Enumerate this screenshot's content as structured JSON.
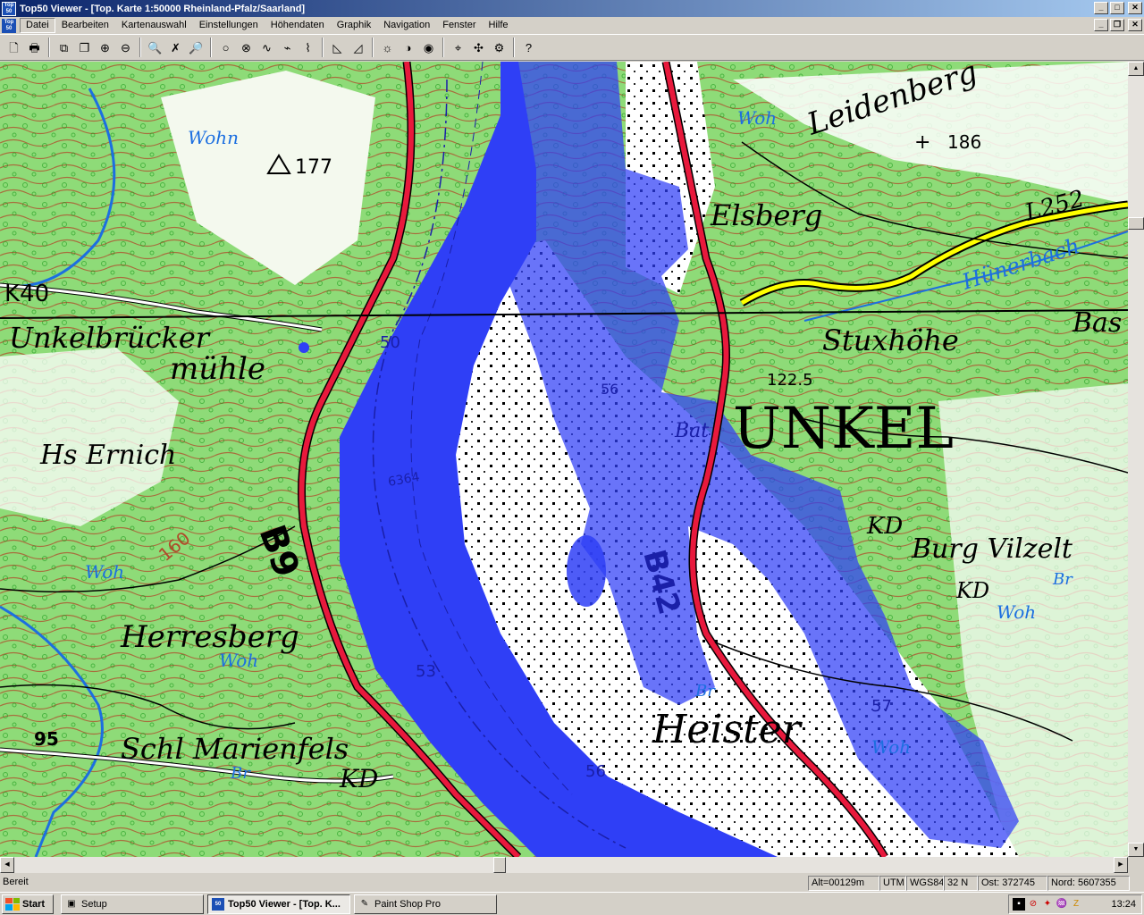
{
  "window": {
    "title": "Top50 Viewer - [Top. Karte 1:50000 Rheinland-Pfalz/Saarland]",
    "app_icon_text": [
      "Top",
      "50"
    ],
    "minimize": "_",
    "maximize": "□",
    "close": "✕"
  },
  "menu": {
    "items": [
      "Datei",
      "Bearbeiten",
      "Kartenauswahl",
      "Einstellungen",
      "Höhendaten",
      "Graphik",
      "Navigation",
      "Fenster",
      "Hilfe"
    ],
    "active_index": 0,
    "mdi_minimize": "_",
    "mdi_restore": "❐",
    "mdi_close": "✕"
  },
  "toolbar": {
    "groups": [
      [
        {
          "icon": "new-icon",
          "glyph": "🗋"
        },
        {
          "icon": "print-icon",
          "glyph": "🖶"
        }
      ],
      [
        {
          "icon": "window-cascade-icon",
          "glyph": "⧉"
        },
        {
          "icon": "window-tile-icon",
          "glyph": "❐"
        },
        {
          "icon": "zoom-in-window-icon",
          "glyph": "⊕"
        },
        {
          "icon": "zoom-out-window-icon",
          "glyph": "⊖"
        }
      ],
      [
        {
          "icon": "zoom-magnifier-icon",
          "glyph": "🔍"
        },
        {
          "icon": "measure-cross-icon",
          "glyph": "✗"
        },
        {
          "icon": "magnifier-minus-icon",
          "glyph": "🔎"
        }
      ],
      [
        {
          "icon": "circle-marker-icon",
          "glyph": "○"
        },
        {
          "icon": "delete-marker-icon",
          "glyph": "⊗"
        },
        {
          "icon": "route-icon",
          "glyph": "∿"
        },
        {
          "icon": "route-text-icon",
          "glyph": "⌁"
        },
        {
          "icon": "route-label-icon",
          "glyph": "⌇"
        }
      ],
      [
        {
          "icon": "profile-icon",
          "glyph": "◺"
        },
        {
          "icon": "profile-edit-icon",
          "glyph": "◿"
        }
      ],
      [
        {
          "icon": "brightness-icon",
          "glyph": "☼"
        },
        {
          "icon": "contrast-icon",
          "glyph": "◑"
        },
        {
          "icon": "saturation-icon",
          "glyph": "◉"
        }
      ],
      [
        {
          "icon": "gps-icon",
          "glyph": "⌖"
        },
        {
          "icon": "gps-track-icon",
          "glyph": "✣"
        },
        {
          "icon": "gps-setup-icon",
          "glyph": "⚙"
        }
      ],
      [
        {
          "icon": "help-cursor-icon",
          "glyph": "?"
        }
      ]
    ]
  },
  "map": {
    "labels": {
      "leidenberg": "Leidenberg",
      "elsberg": "Elsberg",
      "l252": "L252",
      "huenerbach": "Hünerbach",
      "bas": "Bas",
      "stuxhoehe": "Stuxhöhe",
      "unkel": "UNKEL",
      "unkelbruecker": "Unkelbrücker",
      "muehle": "mühle",
      "hs_ernich": "Hs Ernich",
      "b9": "B9",
      "herresberg": "Herresberg",
      "schl_marienfels": "Schl Marienfels",
      "kd1": "KD",
      "kd2": "KD",
      "kd3": "KD",
      "heister": "Heister",
      "burg_vilzelt": "Burg Vilzelt",
      "b42": "B42",
      "k40": "K40",
      "woh1": "Wohn",
      "woh2": "Woh",
      "woh3": "Woh",
      "woh4": "Woh",
      "woh5": "Woh",
      "woh6": "Woh",
      "br1": "Br",
      "br2": "Br",
      "br3": "Br",
      "bat": "Bat",
      "n177": "177",
      "n186": "186",
      "n122": "122.5",
      "n160": "160",
      "n95": "95",
      "n50": "50",
      "n53": "53",
      "n56": "56",
      "n57": "57",
      "n6364": "6364",
      "n56b": "56"
    }
  },
  "statusbar": {
    "ready": "Bereit",
    "alt": "Alt=00129m",
    "utm": "UTM",
    "datum": "WGS84",
    "zone": "32 N",
    "east": "Ost:  372745",
    "north": "Nord: 5607355"
  },
  "taskbar": {
    "start": "Start",
    "tasks": [
      {
        "label": "Setup",
        "active": false
      },
      {
        "label": "Top50 Viewer - [Top. K...",
        "active": true
      },
      {
        "label": "Paint Shop Pro",
        "active": false
      }
    ],
    "clock": "13:24"
  },
  "colors": {
    "water": "#2f3ff6",
    "forest": "#8edb78",
    "road": "#e8193c",
    "road_yellow": "#ffff00",
    "contour": "#b04a2a",
    "titlebar": "#0a246a"
  }
}
